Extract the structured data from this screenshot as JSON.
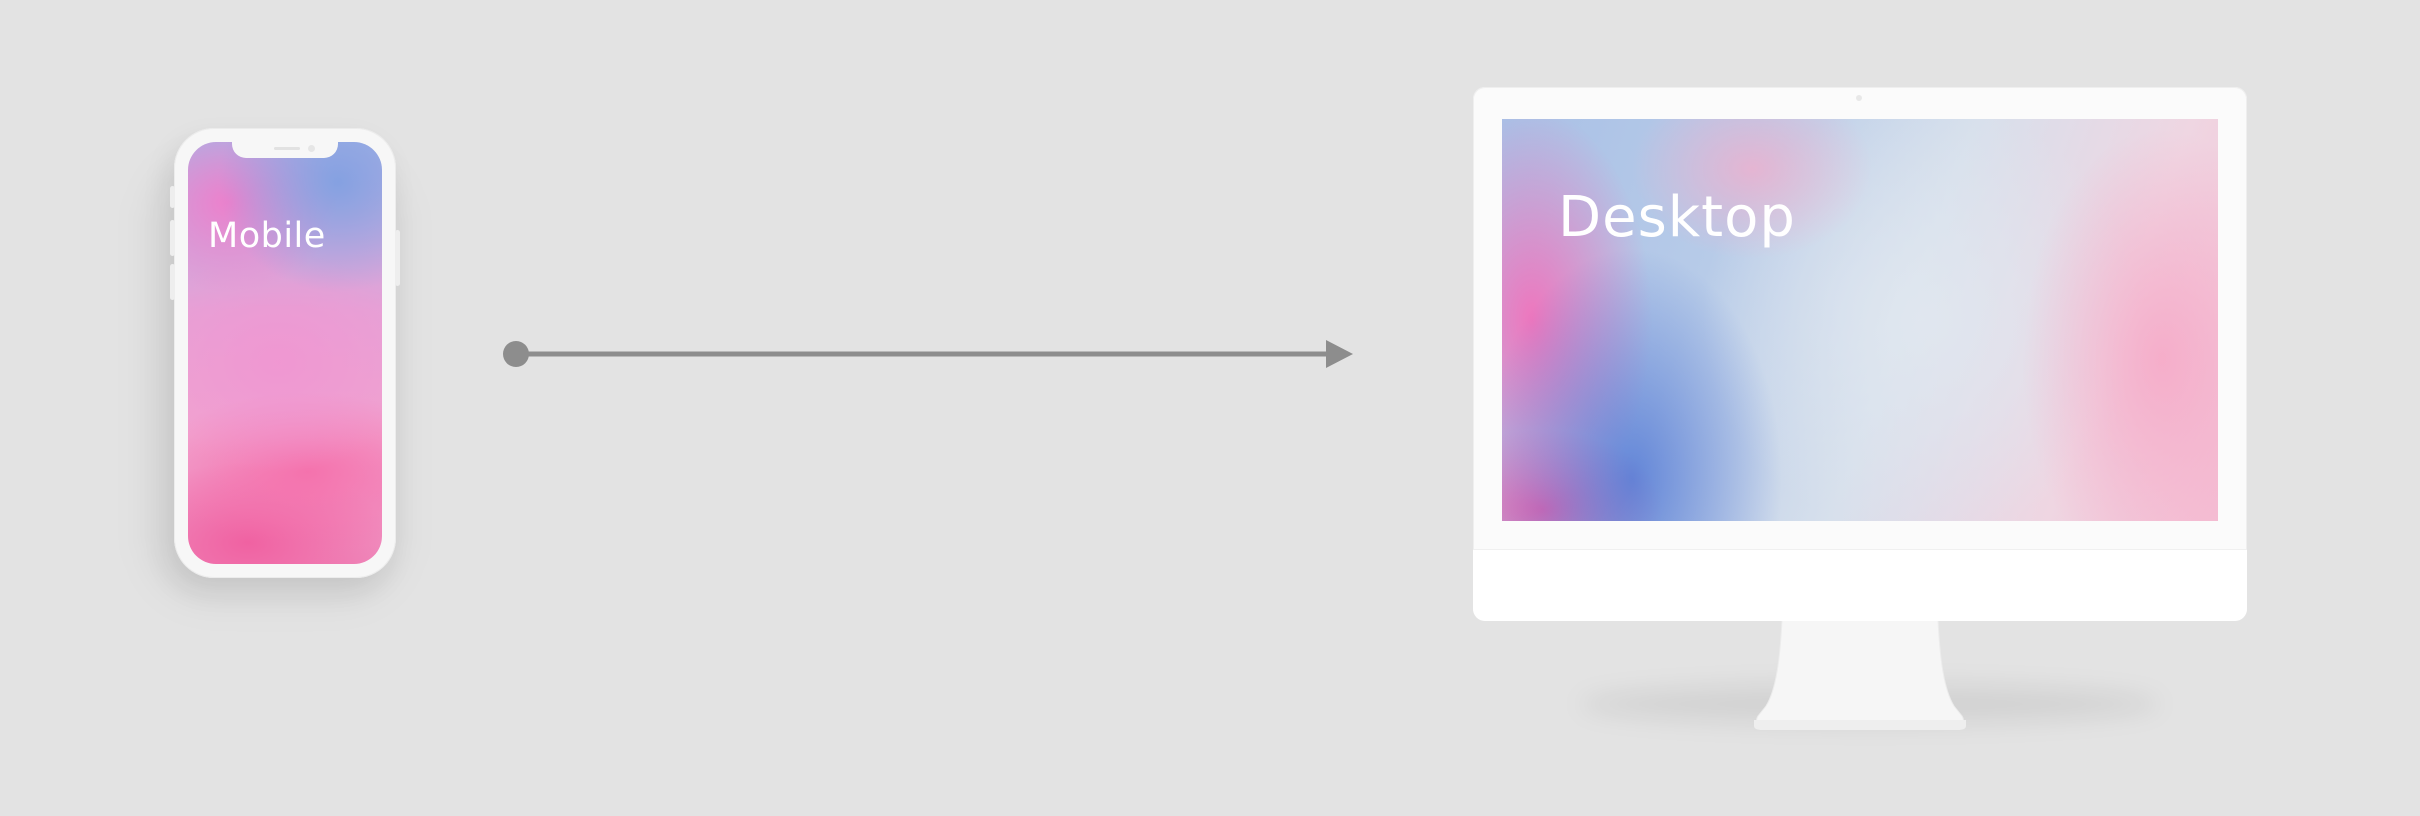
{
  "mobile": {
    "label": "Mobile"
  },
  "desktop": {
    "label": "Desktop"
  },
  "connector": {
    "icon": "arrow-right-icon",
    "color": "#8d8d8d"
  },
  "colors": {
    "background": "#e3e3e3",
    "device_frame": "#f7f7f7"
  }
}
